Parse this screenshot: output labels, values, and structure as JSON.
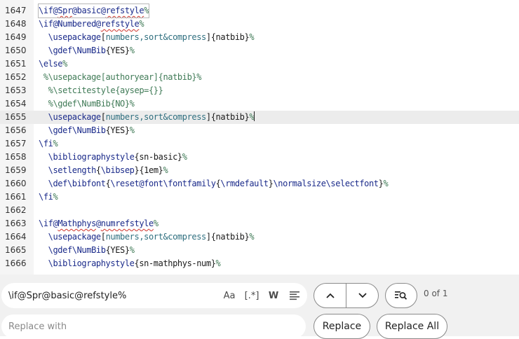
{
  "editor": {
    "lines": [
      {
        "n": "1647",
        "tokens": [
          {
            "t": "\\if@",
            "c": "cmd"
          },
          {
            "t": "Spr",
            "c": "cmd",
            "u": true
          },
          {
            "t": "@basic@",
            "c": "cmd"
          },
          {
            "t": "refstyle",
            "c": "cmd",
            "u": true
          },
          {
            "t": "%",
            "c": "com"
          }
        ],
        "match": true
      },
      {
        "n": "1648",
        "tokens": [
          {
            "t": "\\if@Numbered@",
            "c": "cmd"
          },
          {
            "t": "refstyle",
            "c": "cmd",
            "u": true
          },
          {
            "t": "%",
            "c": "com"
          }
        ]
      },
      {
        "n": "1649",
        "tokens": [
          {
            "t": "  "
          },
          {
            "t": "\\usepackage",
            "c": "cmd"
          },
          {
            "t": "["
          },
          {
            "t": "numbers,sort&compress",
            "c": "key"
          },
          {
            "t": "]{natbib}"
          },
          {
            "t": "%",
            "c": "com"
          }
        ]
      },
      {
        "n": "1650",
        "tokens": [
          {
            "t": "  "
          },
          {
            "t": "\\gdef",
            "c": "cmd"
          },
          {
            "t": "\\NumBib",
            "c": "cmd"
          },
          {
            "t": "{YES}"
          },
          {
            "t": "%",
            "c": "com"
          }
        ]
      },
      {
        "n": "1651",
        "tokens": [
          {
            "t": "\\else",
            "c": "cmd"
          },
          {
            "t": "%",
            "c": "com"
          }
        ]
      },
      {
        "n": "1652",
        "tokens": [
          {
            "t": " %\\usepackage[authoryear]{natbib}%",
            "c": "com"
          }
        ]
      },
      {
        "n": "1653",
        "tokens": [
          {
            "t": "  %\\setcitestyle{aysep={}}",
            "c": "com"
          }
        ]
      },
      {
        "n": "1654",
        "tokens": [
          {
            "t": "  %\\gdef\\NumBib{NO}%",
            "c": "com"
          }
        ]
      },
      {
        "n": "1655",
        "tokens": [
          {
            "t": "  "
          },
          {
            "t": "\\usepackage",
            "c": "cmd"
          },
          {
            "t": "["
          },
          {
            "t": "numbers,sort&compress",
            "c": "key"
          },
          {
            "t": "]{natbib}"
          },
          {
            "t": "%",
            "c": "com"
          }
        ],
        "active": true,
        "cursor": true
      },
      {
        "n": "1656",
        "tokens": [
          {
            "t": "  "
          },
          {
            "t": "\\gdef",
            "c": "cmd"
          },
          {
            "t": "\\NumBib",
            "c": "cmd"
          },
          {
            "t": "{YES}"
          },
          {
            "t": "%",
            "c": "com"
          }
        ]
      },
      {
        "n": "1657",
        "tokens": [
          {
            "t": "\\fi",
            "c": "cmd"
          },
          {
            "t": "%",
            "c": "com"
          }
        ]
      },
      {
        "n": "1658",
        "tokens": [
          {
            "t": "  "
          },
          {
            "t": "\\bibliographystyle",
            "c": "cmd"
          },
          {
            "t": "{sn-basic}"
          },
          {
            "t": "%",
            "c": "com"
          }
        ]
      },
      {
        "n": "1659",
        "tokens": [
          {
            "t": "  "
          },
          {
            "t": "\\setlength",
            "c": "cmd"
          },
          {
            "t": "{"
          },
          {
            "t": "\\bibsep",
            "c": "cmd"
          },
          {
            "t": "}{1em}"
          },
          {
            "t": "%",
            "c": "com"
          }
        ]
      },
      {
        "n": "1660",
        "tokens": [
          {
            "t": "  "
          },
          {
            "t": "\\def",
            "c": "cmd"
          },
          {
            "t": "\\bibfont",
            "c": "cmd"
          },
          {
            "t": "{"
          },
          {
            "t": "\\reset@font",
            "c": "cmd"
          },
          {
            "t": "\\fontfamily",
            "c": "cmd"
          },
          {
            "t": "{"
          },
          {
            "t": "\\rmdefault",
            "c": "cmd"
          },
          {
            "t": "}"
          },
          {
            "t": "\\normalsize",
            "c": "cmd"
          },
          {
            "t": "\\selectfont",
            "c": "cmd"
          },
          {
            "t": "}"
          },
          {
            "t": "%",
            "c": "com"
          }
        ]
      },
      {
        "n": "1661",
        "tokens": [
          {
            "t": "\\fi",
            "c": "cmd"
          },
          {
            "t": "%",
            "c": "com"
          }
        ]
      },
      {
        "n": "1662",
        "tokens": []
      },
      {
        "n": "1663",
        "tokens": [
          {
            "t": "\\if@",
            "c": "cmd"
          },
          {
            "t": "Mathphys",
            "c": "cmd",
            "u": true
          },
          {
            "t": "@",
            "c": "cmd"
          },
          {
            "t": "numrefstyle",
            "c": "cmd",
            "u": true
          },
          {
            "t": "%",
            "c": "com"
          }
        ]
      },
      {
        "n": "1664",
        "tokens": [
          {
            "t": "  "
          },
          {
            "t": "\\usepackage",
            "c": "cmd"
          },
          {
            "t": "["
          },
          {
            "t": "numbers,sort&compress",
            "c": "key"
          },
          {
            "t": "]{natbib}"
          },
          {
            "t": "%",
            "c": "com"
          }
        ]
      },
      {
        "n": "1665",
        "tokens": [
          {
            "t": "  "
          },
          {
            "t": "\\gdef",
            "c": "cmd"
          },
          {
            "t": "\\NumBib",
            "c": "cmd"
          },
          {
            "t": "{YES}"
          },
          {
            "t": "%",
            "c": "com"
          }
        ]
      },
      {
        "n": "1666",
        "tokens": [
          {
            "t": "  "
          },
          {
            "t": "\\bibliographystyle",
            "c": "cmd"
          },
          {
            "t": "{sn-mathphys-num}"
          },
          {
            "t": "%",
            "c": "com"
          }
        ]
      }
    ]
  },
  "find": {
    "query": "\\if@Spr@basic@refstyle%",
    "case_label": "Aa",
    "regex_label": "[.*]",
    "word_label": "W",
    "selection_icon": "selection-lines-icon",
    "prev_icon": "chevron-up-icon",
    "next_icon": "chevron-down-icon",
    "search_all_icon": "search-lines-icon",
    "count": "0 of 1",
    "replace_placeholder": "Replace with",
    "replace_label": "Replace",
    "replace_all_label": "Replace All"
  },
  "colors": {
    "command": "#1a2a8a",
    "keyword": "#2f6f7f",
    "comment": "#3f7a56",
    "active_line": "#ececec",
    "gutter": "#f5f5f5"
  }
}
